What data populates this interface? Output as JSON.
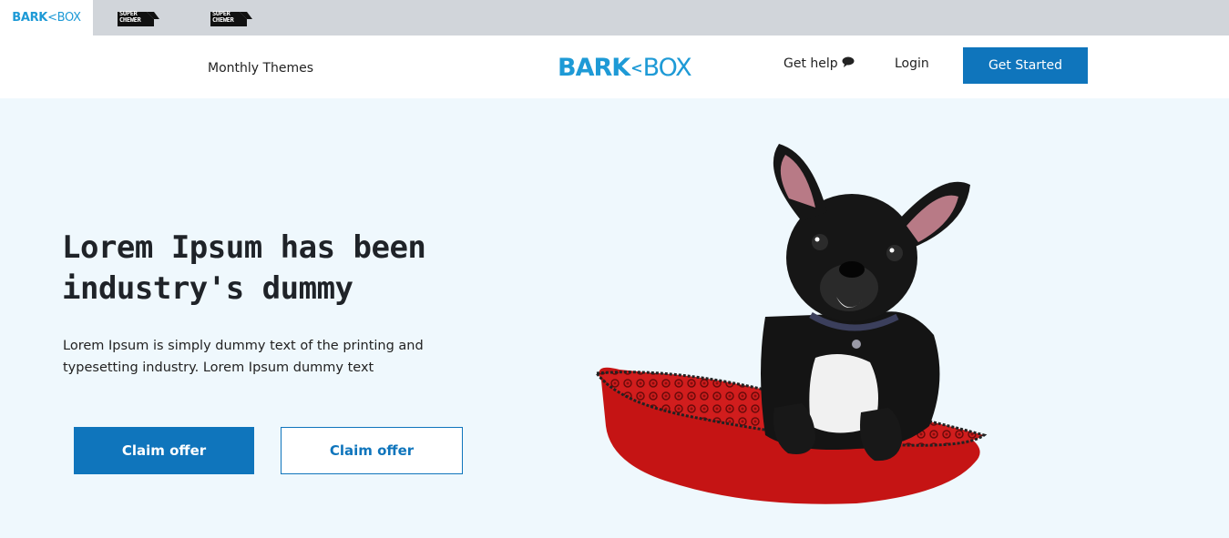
{
  "brand_tabs": {
    "barkbox": {
      "bark": "BARK",
      "sep": "<",
      "box": "BOX"
    },
    "super_chewer_1": {
      "line1": "SUPER",
      "line2": "CHEWER"
    },
    "super_chewer_2": {
      "line1": "SUPER",
      "line2": "CHEWER"
    }
  },
  "header": {
    "monthly_themes": "Monthly Themes",
    "logo": {
      "bark": "BARK",
      "sep": "<",
      "box": "BOX"
    },
    "get_help": "Get help",
    "login": "Login",
    "get_started": "Get Started"
  },
  "hero": {
    "title": "Lorem Ipsum has been industry's dummy",
    "subtitle": "Lorem Ipsum is simply dummy text of the printing and typesetting industry. Lorem Ipsum dummy text",
    "primary_button": "Claim offer",
    "secondary_button": "Claim offer"
  },
  "colors": {
    "brand_blue": "#1e9ad6",
    "button_blue": "#0f75bc",
    "hero_bg": "#eff8fd",
    "strip_bg": "#d1d5da"
  },
  "icons": {
    "help": "chat-bubble-icon"
  }
}
